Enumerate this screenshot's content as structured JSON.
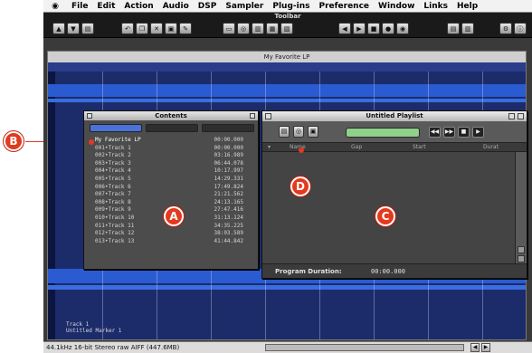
{
  "menubar": {
    "apple_glyph": "◉",
    "items": [
      "File",
      "Edit",
      "Action",
      "Audio",
      "DSP",
      "Sampler",
      "Plug-ins",
      "Preference",
      "Window",
      "Links",
      "Help"
    ]
  },
  "toolbar": {
    "title": "Toolbar"
  },
  "main_window": {
    "title": "My Favorite LP",
    "marker_label_1": "Track 1",
    "marker_label_2": "Untitled Marker 1"
  },
  "status_bar": {
    "text": "44.1kHz 16-bit Stereo raw AIFF (447.6MB)"
  },
  "contents_window": {
    "title": "Contents",
    "items": [
      {
        "name": "My Favorite LP",
        "time": "00:00.000"
      },
      {
        "name": "001•Track 1",
        "time": "00:00.000"
      },
      {
        "name": "002•Track 2",
        "time": "03:16.989"
      },
      {
        "name": "003•Track 3",
        "time": "06:44.078"
      },
      {
        "name": "004•Track 4",
        "time": "10:17.997"
      },
      {
        "name": "005•Track 5",
        "time": "14:29.331"
      },
      {
        "name": "006•Track 6",
        "time": "17:49.824"
      },
      {
        "name": "007•Track 7",
        "time": "21:21.562"
      },
      {
        "name": "008•Track 8",
        "time": "24:13.165"
      },
      {
        "name": "009•Track 9",
        "time": "27:47.416"
      },
      {
        "name": "010•Track 10",
        "time": "31:13.124"
      },
      {
        "name": "011•Track 11",
        "time": "34:35.225"
      },
      {
        "name": "012•Track 12",
        "time": "38:03.589"
      },
      {
        "name": "013•Track 13",
        "time": "41:44.842"
      }
    ]
  },
  "playlist_window": {
    "title": "Untitled Playlist",
    "columns": [
      "Name",
      "Gap",
      "Start",
      "Durat"
    ],
    "footer_label": "Program Duration:",
    "footer_value": "00:00.000"
  },
  "callouts": {
    "a": "A",
    "b": "B",
    "c": "C",
    "d": "D"
  },
  "colors": {
    "callout": "#e23a1f",
    "waveform": "#2a5bd0",
    "lcd": "#8fd08a"
  }
}
